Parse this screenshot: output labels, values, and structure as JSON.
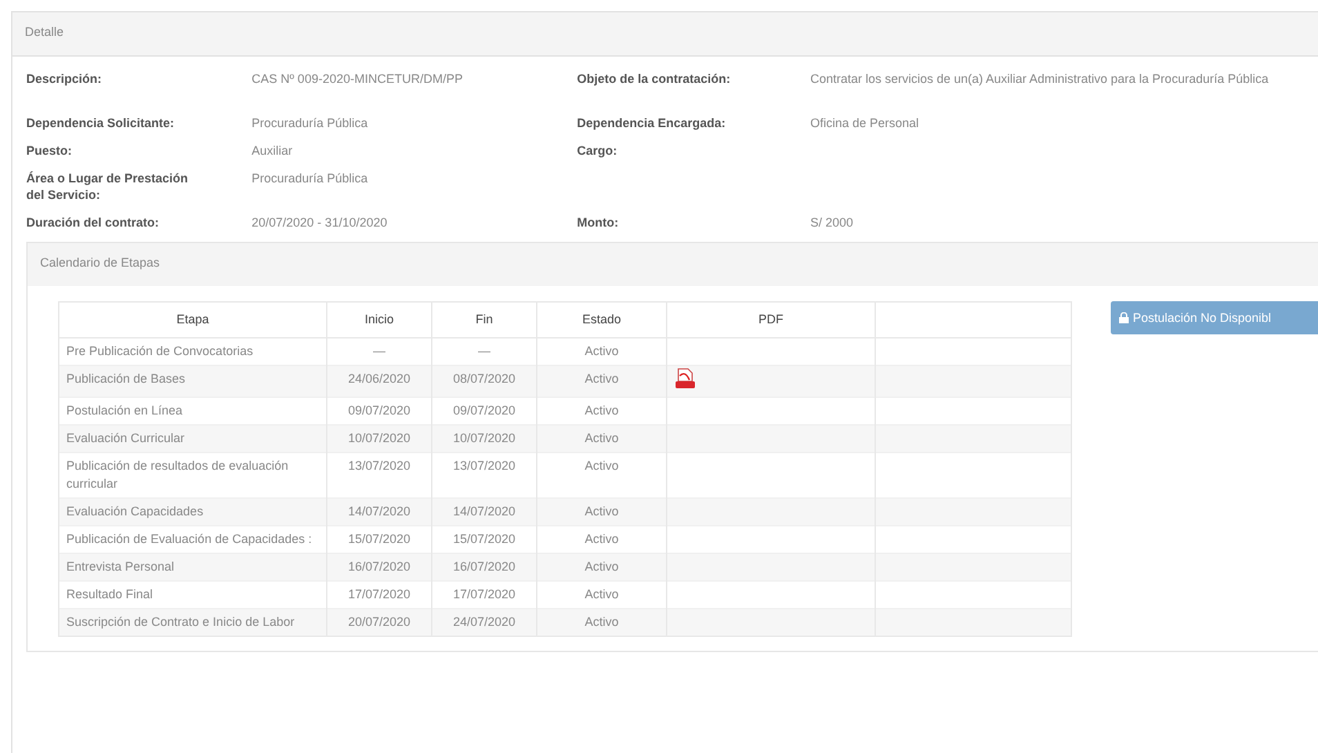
{
  "panel": {
    "title": "Detalle"
  },
  "details": [
    {
      "label": "Descripción:",
      "value": "CAS Nº 009-2020-MINCETUR/DM/PP",
      "label2": "Objeto de la contratación:",
      "value2": "Contratar los servicios de un(a) Auxiliar Administrativo para la Procuraduría Pública"
    },
    {
      "label": "Dependencia Solicitante:",
      "value": "Procuraduría Pública",
      "label2": "Dependencia Encargada:",
      "value2": "Oficina de Personal"
    },
    {
      "label": "Puesto:",
      "value": "Auxiliar",
      "label2": "Cargo:"
    },
    {
      "label": "Área o Lugar de Prestación del Servicio:",
      "value": "Procuraduría Pública"
    },
    {
      "label": "Duración del contrato:",
      "value": "20/07/2020 - 31/10/2020",
      "label2": "Monto:",
      "value2": "S/ 2000"
    }
  ],
  "calendar": {
    "title": "Calendario de Etapas",
    "columns": [
      "Etapa",
      "Inicio",
      "Fin",
      "Estado",
      "PDF"
    ],
    "rows": [
      {
        "etapa": "Pre Publicación de Convocatorias",
        "inicio": "—",
        "fin": "—",
        "estado": "Activo",
        "pdf": false
      },
      {
        "etapa": "Publicación de Bases",
        "inicio": "24/06/2020",
        "fin": "08/07/2020",
        "estado": "Activo",
        "pdf": true
      },
      {
        "etapa": "Postulación en Línea",
        "inicio": "09/07/2020",
        "fin": "09/07/2020",
        "estado": "Activo",
        "pdf": false
      },
      {
        "etapa": "Evaluación Curricular",
        "inicio": "10/07/2020",
        "fin": "10/07/2020",
        "estado": "Activo",
        "pdf": false
      },
      {
        "etapa": "Publicación de resultados de evaluación curricular",
        "inicio": "13/07/2020",
        "fin": "13/07/2020",
        "estado": "Activo",
        "pdf": false
      },
      {
        "etapa": "Evaluación Capacidades",
        "inicio": "14/07/2020",
        "fin": "14/07/2020",
        "estado": "Activo",
        "pdf": false
      },
      {
        "etapa": "Publicación de Evaluación de Capacidades :",
        "inicio": "15/07/2020",
        "fin": "15/07/2020",
        "estado": "Activo",
        "pdf": false
      },
      {
        "etapa": "Entrevista Personal",
        "inicio": "16/07/2020",
        "fin": "16/07/2020",
        "estado": "Activo",
        "pdf": false
      },
      {
        "etapa": "Resultado Final",
        "inicio": "17/07/2020",
        "fin": "17/07/2020",
        "estado": "Activo",
        "pdf": false
      },
      {
        "etapa": "Suscripción de Contrato e Inicio de Labor",
        "inicio": "20/07/2020",
        "fin": "24/07/2020",
        "estado": "Activo",
        "pdf": false
      }
    ],
    "button": {
      "label": "Postulación No Disponibl",
      "disabled": true
    }
  }
}
